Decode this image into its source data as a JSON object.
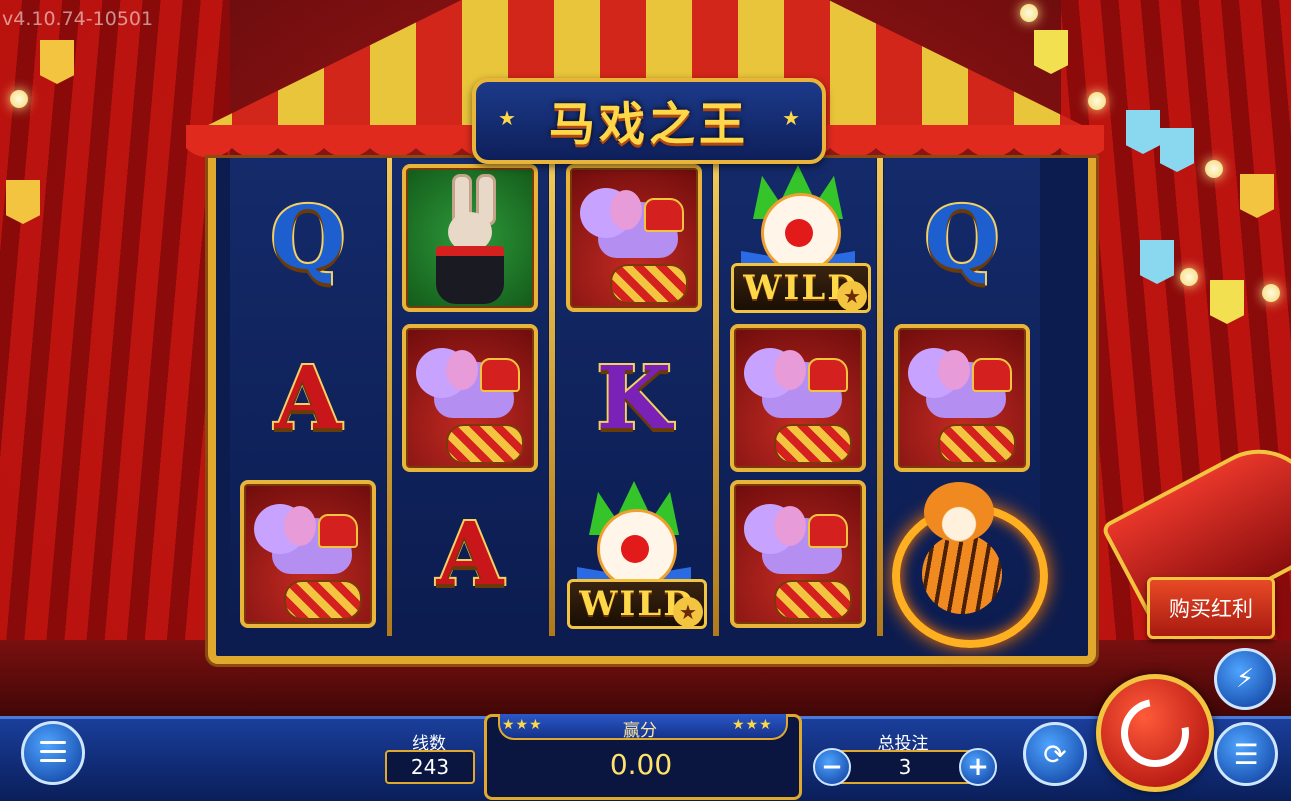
{
  "version": "v4.10.74-10501",
  "game_title": "马戏之王",
  "reels": [
    [
      {
        "symbol": "letter",
        "label": "Q",
        "variant": "q"
      },
      {
        "symbol": "letter",
        "label": "A",
        "variant": "a"
      },
      {
        "symbol": "elephant-card"
      }
    ],
    [
      {
        "symbol": "rabbit-card"
      },
      {
        "symbol": "elephant-card"
      },
      {
        "symbol": "letter",
        "label": "A",
        "variant": "a"
      }
    ],
    [
      {
        "symbol": "elephant-card"
      },
      {
        "symbol": "letter",
        "label": "K",
        "variant": "k"
      },
      {
        "symbol": "wild",
        "label": "WILD"
      }
    ],
    [
      {
        "symbol": "wild",
        "label": "WILD"
      },
      {
        "symbol": "elephant-card"
      },
      {
        "symbol": "elephant-card"
      }
    ],
    [
      {
        "symbol": "letter",
        "label": "Q",
        "variant": "q"
      },
      {
        "symbol": "elephant-card"
      },
      {
        "symbol": "tiger-ring"
      }
    ]
  ],
  "buy_bonus_label": "购买红利",
  "lines": {
    "label": "线数",
    "value": "243"
  },
  "win": {
    "label": "赢分",
    "value": "0.00"
  },
  "bet": {
    "label": "总投注",
    "value": "3",
    "minus": "−",
    "plus": "+"
  },
  "icons": {
    "menu": "hamburger-menu-icon",
    "turbo": "lightning-icon",
    "autoplay": "autoplay-refresh-icon",
    "spin": "spin-arrow-icon",
    "coins": "coin-stack-icon"
  },
  "colors": {
    "accent_gold": "#e0a92e",
    "bar_blue": "#1a3e9a",
    "spin_red": "#d41a10"
  }
}
